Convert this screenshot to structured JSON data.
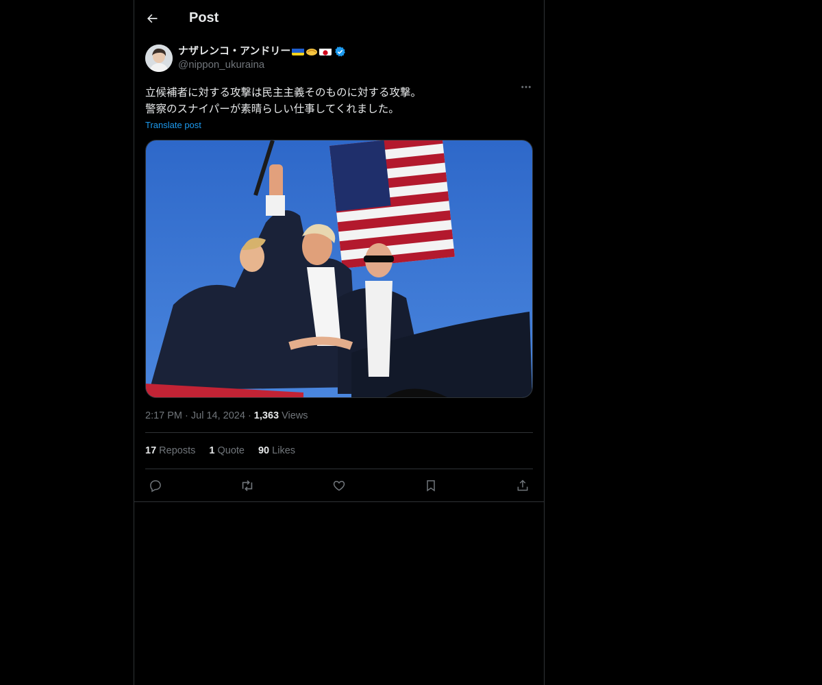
{
  "header": {
    "title": "Post"
  },
  "author": {
    "name": "ナザレンコ・アンドリー",
    "handle": "@nippon_ukuraina"
  },
  "post": {
    "text": "立候補者に対する攻撃は民主主義そのものに対する攻撃。\n警察のスナイパーが素晴らしい仕事してくれました。",
    "translate_label": "Translate post"
  },
  "meta": {
    "time": "2:17 PM",
    "date": "Jul 14, 2024",
    "views_count": "1,363",
    "views_label": "Views"
  },
  "stats": {
    "reposts_count": "17",
    "reposts_label": "Reposts",
    "quotes_count": "1",
    "quotes_label": "Quote",
    "likes_count": "90",
    "likes_label": "Likes"
  },
  "colors": {
    "background": "#000000",
    "text": "#e7e9ea",
    "muted": "#71767b",
    "accent": "#1d9bf0",
    "border": "#2f3336"
  },
  "icons": {
    "back": "arrow-left-icon",
    "more": "more-horizontal-icon",
    "verified": "verified-badge-icon",
    "reply": "reply-icon",
    "repost": "repost-icon",
    "like": "heart-icon",
    "bookmark": "bookmark-icon",
    "share": "share-icon"
  }
}
